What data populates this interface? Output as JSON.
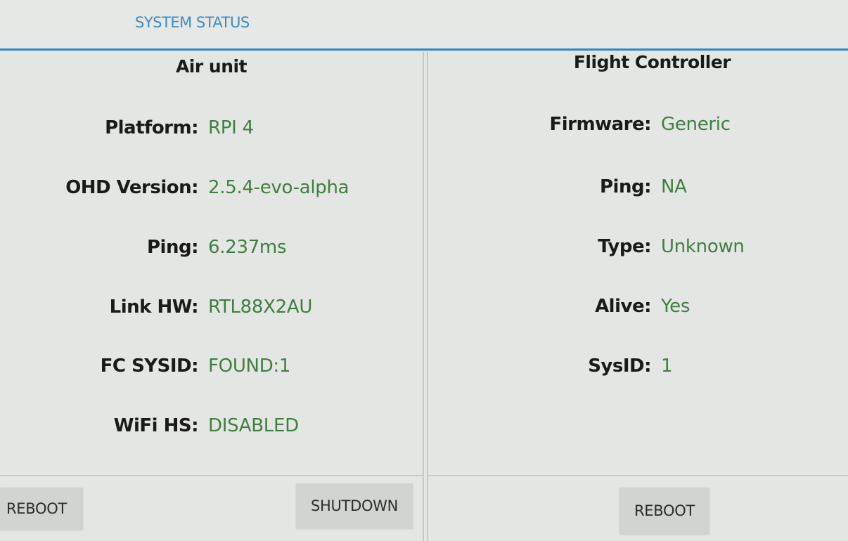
{
  "tabs": [
    {
      "label": "SYSTEM STATUS"
    }
  ],
  "air_unit": {
    "title": "Air unit",
    "rows": [
      {
        "label": "Platform:",
        "value": "RPI 4"
      },
      {
        "label": "OHD Version:",
        "value": "2.5.4-evo-alpha"
      },
      {
        "label": "Ping:",
        "value": "6.237ms"
      },
      {
        "label": "Link HW:",
        "value": "RTL88X2AU"
      },
      {
        "label": "FC SYSID:",
        "value": "FOUND:1"
      },
      {
        "label": "WiFi HS:",
        "value": "DISABLED"
      }
    ],
    "reboot_label": "REBOOT",
    "shutdown_label": "SHUTDOWN"
  },
  "flight_controller": {
    "title": "Flight Controller",
    "rows": [
      {
        "label": "Firmware:",
        "value": "Generic"
      },
      {
        "label": "Ping:",
        "value": "NA"
      },
      {
        "label": "Type:",
        "value": "Unknown"
      },
      {
        "label": "Alive:",
        "value": "Yes"
      },
      {
        "label": "SysID:",
        "value": "1"
      }
    ],
    "reboot_label": "REBOOT"
  },
  "colors": {
    "accent": "#2f86c6",
    "value_text": "#3f7f3f",
    "label_text": "#1a1a1a",
    "background": "#e4e6e3"
  }
}
